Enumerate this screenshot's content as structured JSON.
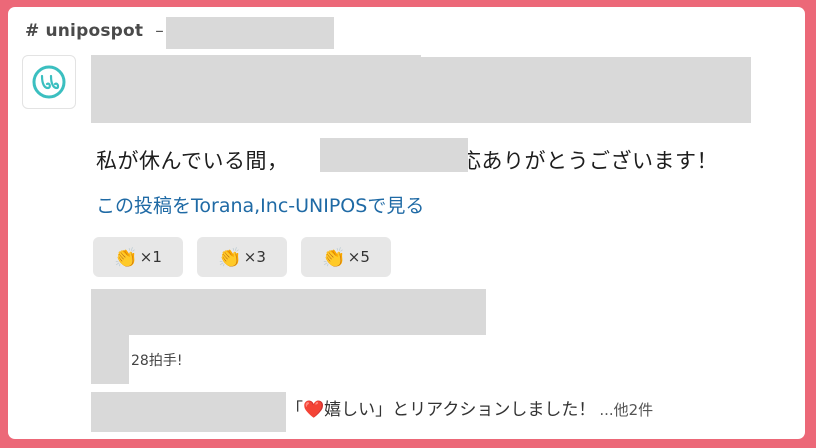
{
  "header": {
    "channel_hash": "#",
    "channel_name": "unipospot",
    "separator": "–"
  },
  "avatar": {
    "icon": "unipos-logo-icon",
    "brand_color": "#3bbfc0"
  },
  "message": {
    "text_before": "私が休んでいる間，",
    "text_after": "対応ありがとうございます！"
  },
  "link": {
    "label": "この投稿をTorana,Inc-UNIPOSで見る",
    "color": "#1f6aa5"
  },
  "reactions": [
    {
      "icon": "clap-icon",
      "emoji": "👏",
      "count": "×1"
    },
    {
      "icon": "clap-icon",
      "emoji": "👏",
      "count": "×3"
    },
    {
      "icon": "clap-icon",
      "emoji": "👏",
      "count": "×5"
    }
  ],
  "applause": {
    "text": "28拍手!"
  },
  "reaction_summary": {
    "open_bracket": "「",
    "heart": "❤️",
    "reaction_text": "嬉しい」とリアクションしました！",
    "more": "...他2件"
  },
  "colors": {
    "border": "#ec6878",
    "link": "#1f6aa5",
    "redacted": "#d9d9d9"
  }
}
